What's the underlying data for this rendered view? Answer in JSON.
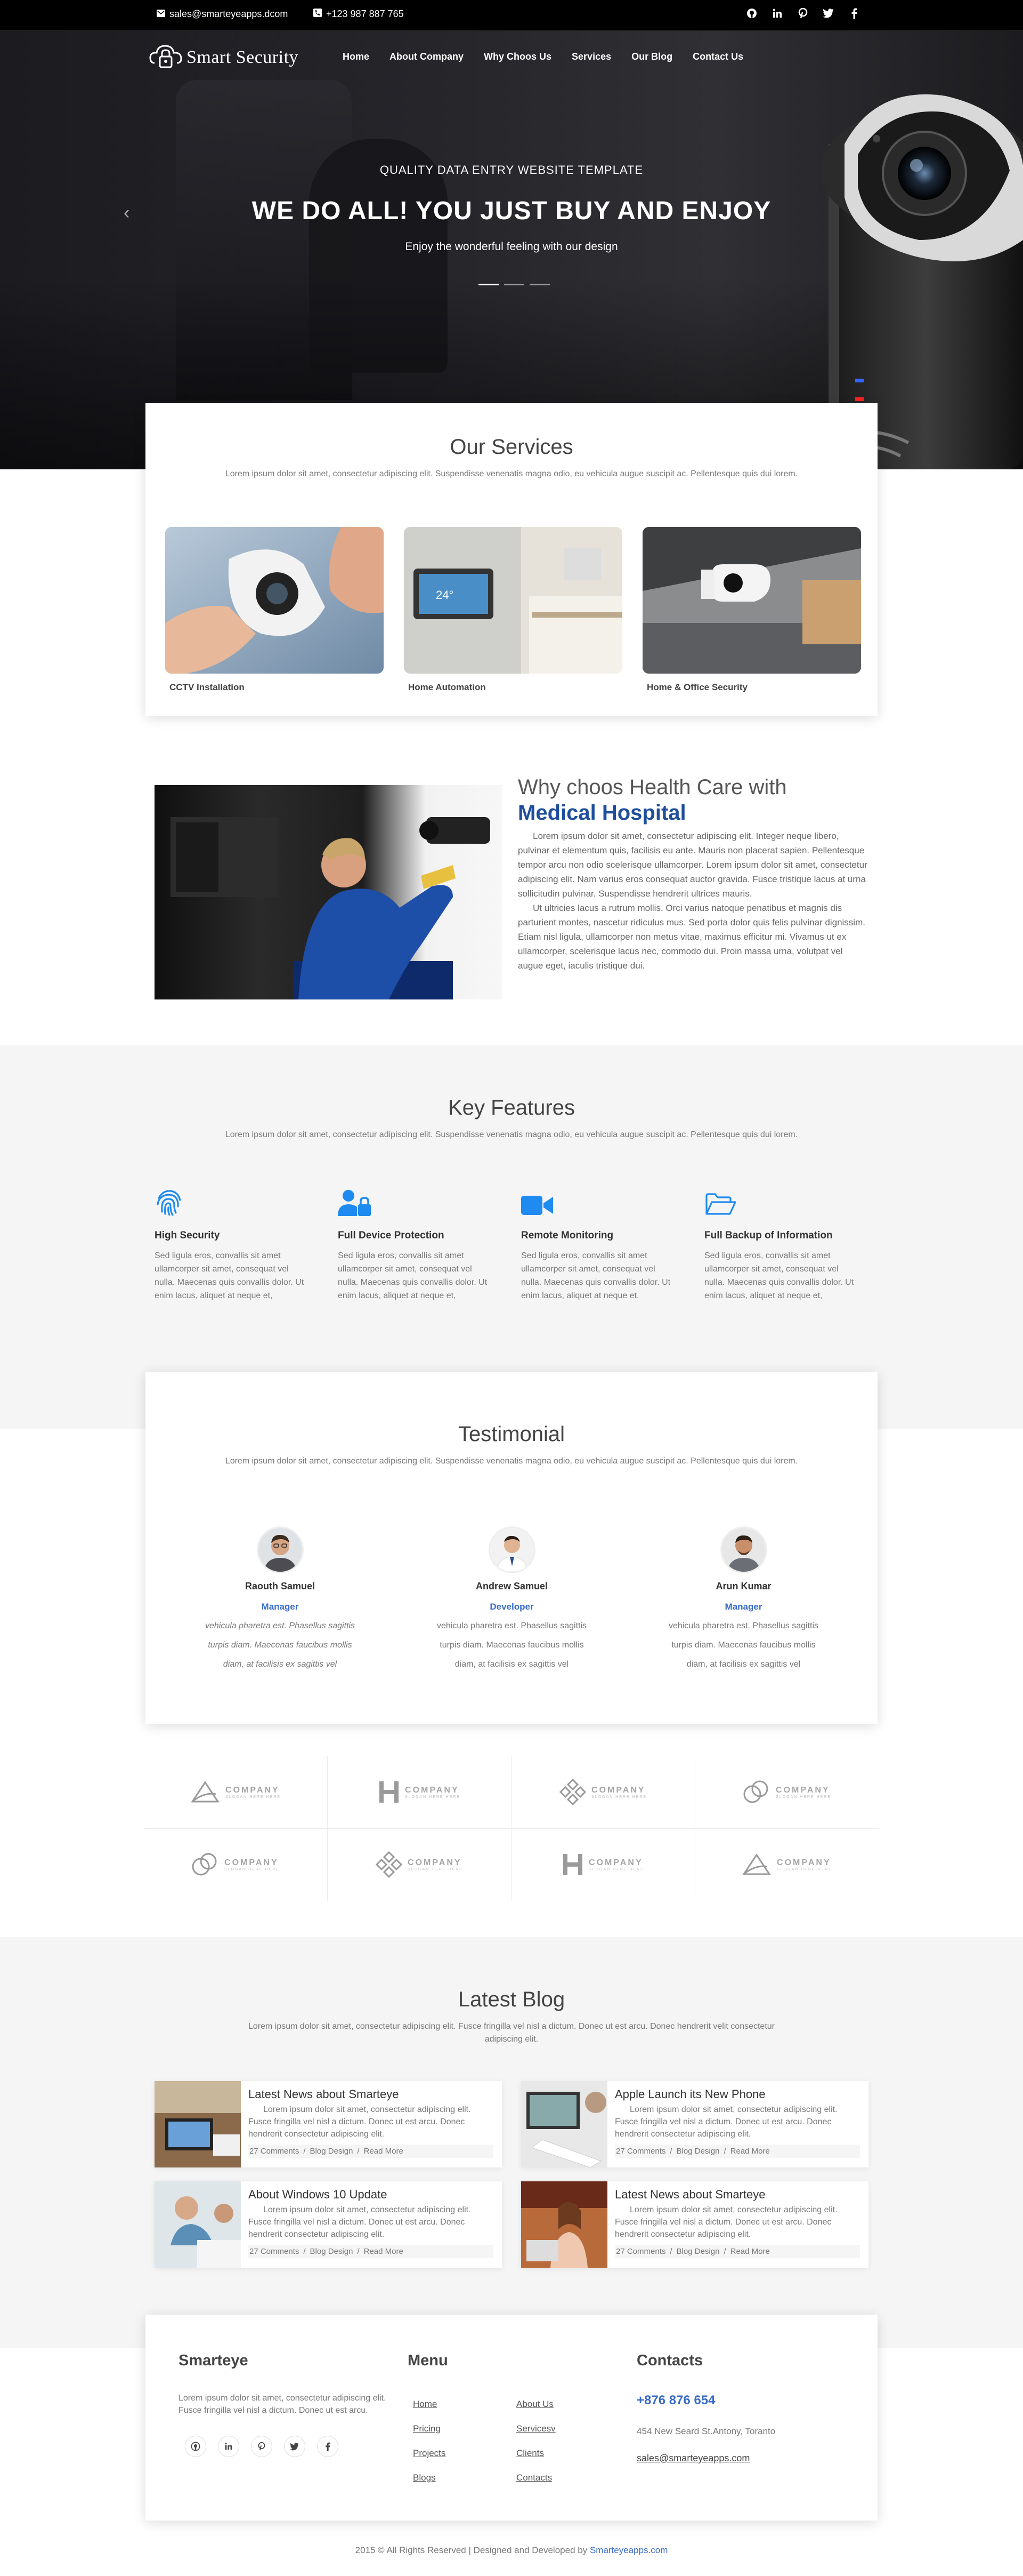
{
  "topbar": {
    "email": "sales@smarteyeapps.dcom",
    "phone": "+123 987 887 765",
    "socials": [
      "github-icon",
      "linkedin-icon",
      "pinterest-icon",
      "twitter-icon",
      "facebook-icon"
    ]
  },
  "nav": {
    "logo_text": "Smart Security",
    "items": [
      "Home",
      "About Company",
      "Why Choos Us",
      "Services",
      "Our Blog",
      "Contact Us"
    ]
  },
  "hero": {
    "kicker": "QUALITY DATA ENTRY WEBSITE TEMPLATE",
    "headline": "WE DO ALL! YOU JUST BUY AND ENJOY",
    "subline": "Enjoy the wonderful feeling with our design",
    "slide_count": 3,
    "active_slide": 1
  },
  "services": {
    "title": "Our Services",
    "desc": "Lorem ipsum dolor sit amet, consectetur adipiscing elit. Suspendisse venenatis magna odio, eu vehicula augue suscipit ac. Pellentesque quis dui lorem.",
    "items": [
      "CCTV Installation",
      "Home Automation",
      "Home & Office Security"
    ]
  },
  "why": {
    "title_line1": "Why choos Health Care with",
    "title_line2": "Medical Hospital",
    "p1": "Lorem ipsum dolor sit amet, consectetur adipiscing elit. Integer neque libero, pulvinar et elementum quis, facilisis eu ante. Mauris non placerat sapien. Pellentesque tempor arcu non odio scelerisque ullamcorper. Lorem ipsum dolor sit amet, consectetur adipiscing elit. Nam varius eros consequat auctor gravida. Fusce tristique lacus at urna sollicitudin pulvinar. Suspendisse hendrerit ultrices mauris.",
    "p2": "Ut ultricies lacus a rutrum mollis. Orci varius natoque penatibus et magnis dis parturient montes, nascetur ridiculus mus. Sed porta dolor quis felis pulvinar dignissim. Etiam nisl ligula, ullamcorper non metus vitae, maximus efficitur mi. Vivamus ut ex ullamcorper, scelerisque lacus nec, commodo dui. Proin massa urna, volutpat vel augue eget, iaculis tristique dui."
  },
  "features": {
    "title": "Key Features",
    "desc": "Lorem ipsum dolor sit amet, consectetur adipiscing elit. Suspendisse venenatis magna odio, eu vehicula augue suscipit ac. Pellentesque quis dui lorem.",
    "accent": "#1f8bf0",
    "items": [
      {
        "icon": "fingerprint-icon",
        "title": "High Security",
        "text": "Sed ligula eros, convallis sit amet ullamcorper sit amet, consequat vel nulla. Maecenas quis convallis dolor. Ut enim lacus, aliquet at neque et,"
      },
      {
        "icon": "user-lock-icon",
        "title": "Full Device Protection",
        "text": "Sed ligula eros, convallis sit amet ullamcorper sit amet, consequat vel nulla. Maecenas quis convallis dolor. Ut enim lacus, aliquet at neque et,"
      },
      {
        "icon": "video-camera-icon",
        "title": "Remote Monitoring",
        "text": "Sed ligula eros, convallis sit amet ullamcorper sit amet, consequat vel nulla. Maecenas quis convallis dolor. Ut enim lacus, aliquet at neque et,"
      },
      {
        "icon": "folder-open-icon",
        "title": "Full Backup of Information",
        "text": "Sed ligula eros, convallis sit amet ullamcorper sit amet, consequat vel nulla. Maecenas quis convallis dolor. Ut enim lacus, aliquet at neque et,"
      }
    ]
  },
  "testimonial": {
    "title": "Testimonial",
    "desc": "Lorem ipsum dolor sit amet, consectetur adipiscing elit. Suspendisse venenatis magna odio, eu vehicula augue suscipit ac. Pellentesque quis dui lorem.",
    "items": [
      {
        "name": "Raouth Samuel",
        "role": "Manager",
        "l1": "vehicula pharetra est. Phasellus sagittis",
        "l2": "turpis diam. Maecenas faucibus mollis",
        "l3": "diam, at facilisis ex sagittis vel"
      },
      {
        "name": "Andrew Samuel",
        "role": "Developer",
        "l1": "vehicula pharetra est. Phasellus sagittis",
        "l2": "turpis diam. Maecenas faucibus mollis",
        "l3": "diam, at facilisis ex sagittis vel"
      },
      {
        "name": "Arun Kumar",
        "role": "Manager",
        "l1": "vehicula pharetra est. Phasellus sagittis",
        "l2": "turpis diam. Maecenas faucibus mollis",
        "l3": "diam, at facilisis ex sagittis vel"
      }
    ]
  },
  "logos": {
    "word": "COMPANY",
    "slogan": "SLOGAN HERE HERE"
  },
  "blog": {
    "title": "Latest Blog",
    "desc": "Lorem ipsum dolor sit amet, consectetur adipiscing elit. Fusce fringilla vel nisl a dictum. Donec ut est arcu. Donec hendrerit velit consectetur adipiscing elit.",
    "excerpt": "Lorem ipsum dolor sit amet, consectetur adipiscing elit. Fusce fringilla vel nisl a dictum. Donec ut est arcu. Donec hendrerit consectetur adipiscing elit.",
    "comments": "27 Comments",
    "category": "Blog Design",
    "more": "Read More",
    "posts": [
      "Latest News about Smarteye",
      "Apple Launch its New Phone",
      "About Windows 10 Update",
      "Latest News about Smarteye"
    ]
  },
  "footer": {
    "brand": "Smarteye",
    "about": "Lorem ipsum dolor sit amet, consectetur adipiscing elit. Fusce fringilla vel nisl a dictum. Donec ut est arcu.",
    "menu_title": "Menu",
    "menu_col1": [
      "Home",
      "Pricing",
      "Projects",
      "Blogs"
    ],
    "menu_col2": [
      "About Us",
      "Servicesv",
      "Clients",
      "Contacts"
    ],
    "contacts_title": "Contacts",
    "phone": "+876 876 654",
    "address": "454 New Seard St.Antony, Toranto",
    "email": "sales@smarteyeapps.com",
    "copyright": "2015 © All Rights Reserved | Designed and Developed by",
    "credit": "Smarteyeapps.com"
  }
}
